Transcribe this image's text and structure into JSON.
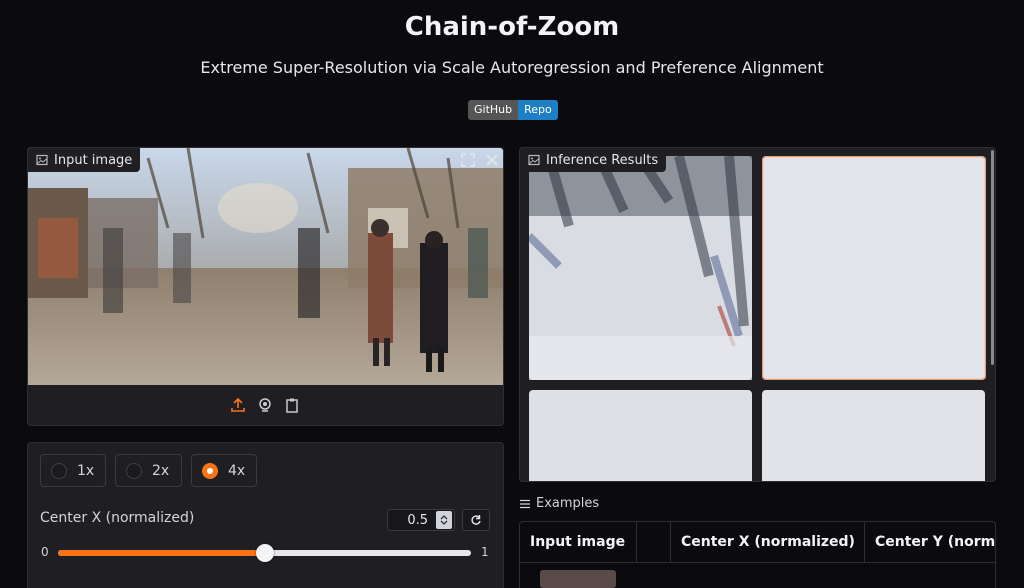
{
  "header": {
    "title": "Chain-of-Zoom",
    "subtitle": "Extreme Super-Resolution via Scale Autoregression and Preference Alignment",
    "badge": {
      "left": "GitHub",
      "right": "Repo"
    }
  },
  "input_panel": {
    "label": "Input image",
    "label_icon": "image-icon",
    "actions": [
      "fullscreen-icon",
      "close-icon"
    ],
    "sources": [
      "upload-icon",
      "webcam-icon",
      "clipboard-icon"
    ]
  },
  "controls": {
    "zoom_options": [
      "1x",
      "2x",
      "4x"
    ],
    "zoom_selected": "4x",
    "center_x": {
      "label": "Center X (normalized)",
      "value": "0.5",
      "min": "0",
      "max": "1",
      "fraction": 0.5
    }
  },
  "results_panel": {
    "label": "Inference Results",
    "label_icon": "image-icon"
  },
  "examples": {
    "label": "Examples",
    "columns": [
      "Input image",
      "",
      "Center X (normalized)",
      "Center Y (norm"
    ]
  },
  "colors": {
    "accent": "#f97316",
    "badge_blue": "#1f7fc4"
  }
}
